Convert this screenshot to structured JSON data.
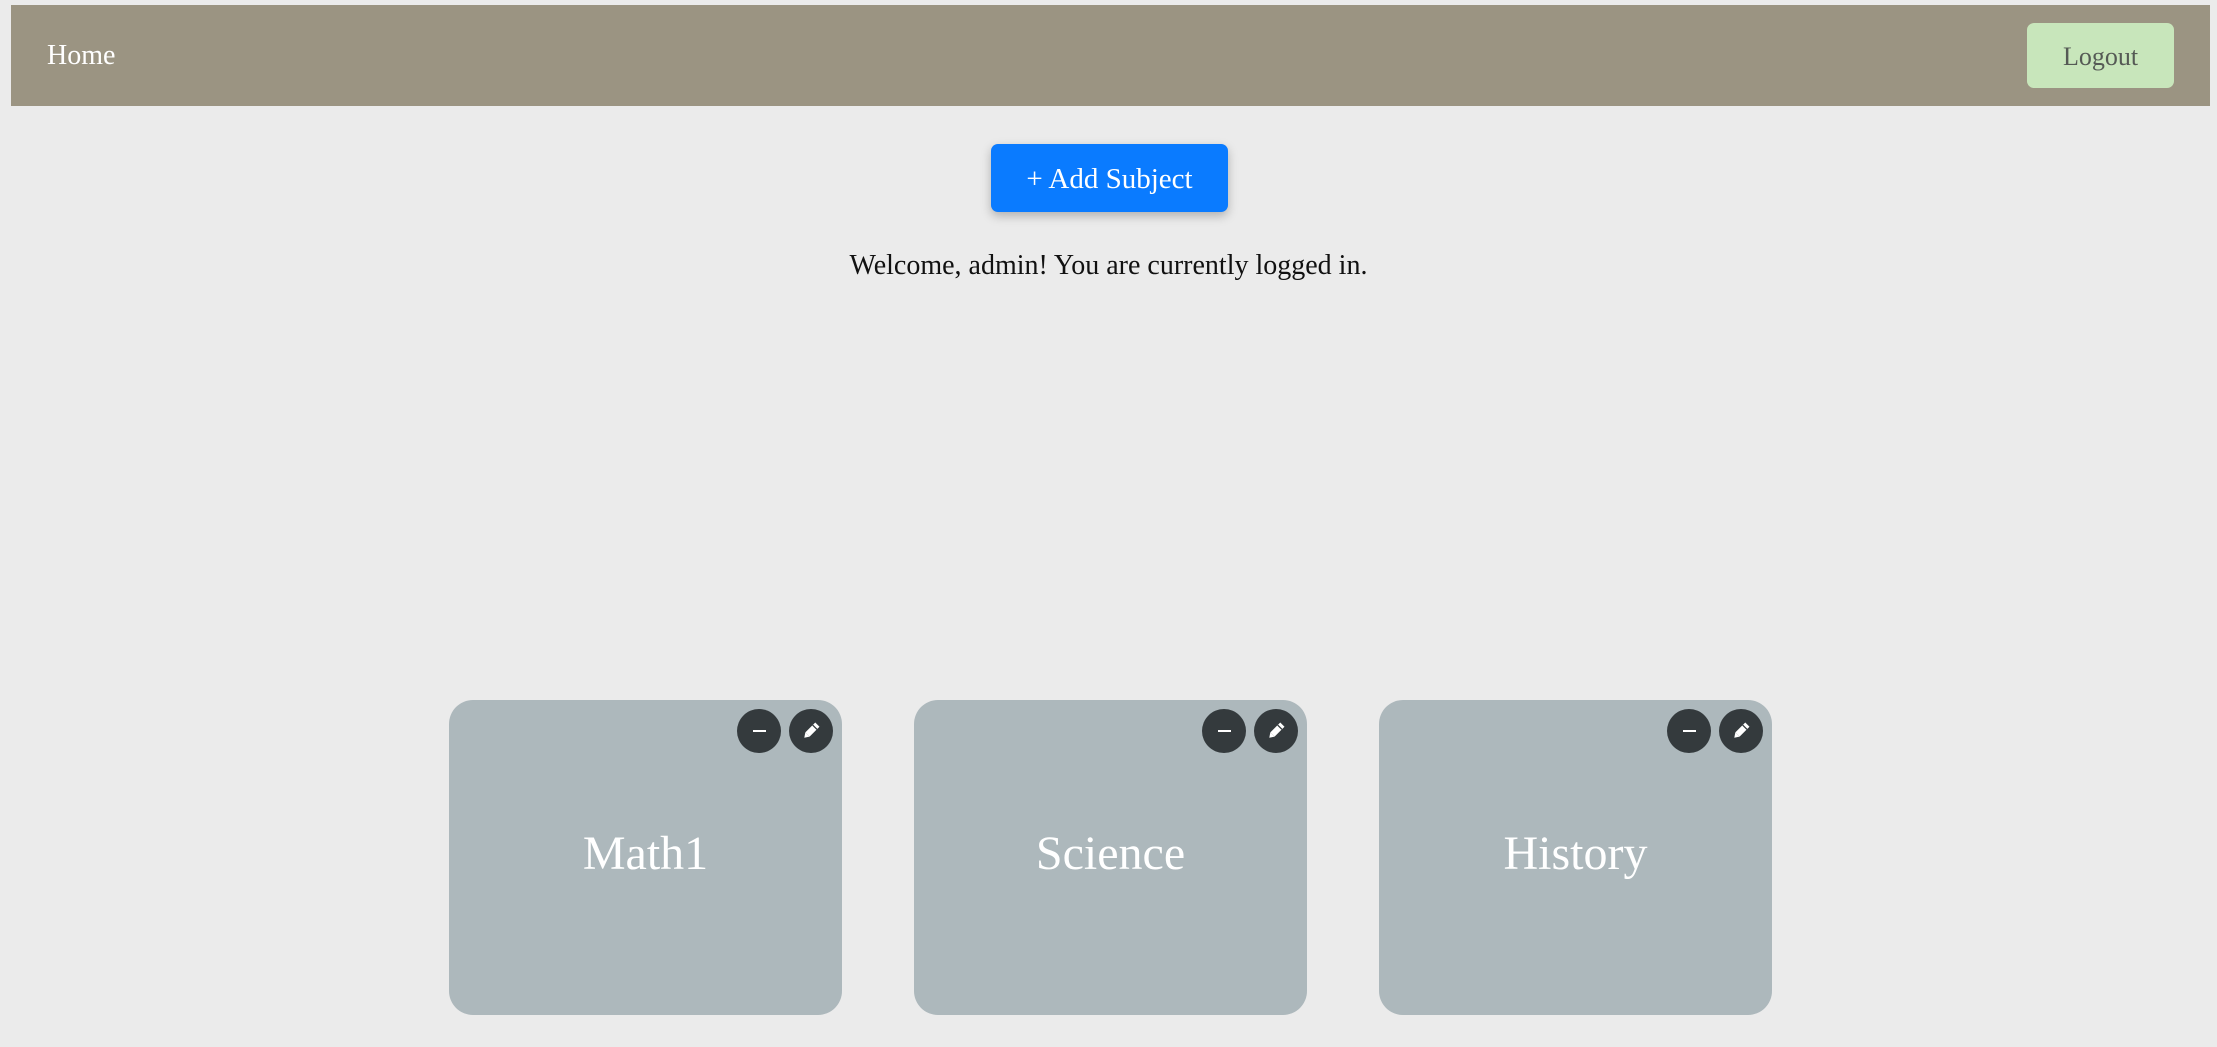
{
  "nav": {
    "home_label": "Home",
    "logout_label": "Logout"
  },
  "main": {
    "add_subject_label": "+ Add Subject",
    "welcome_text": "Welcome, admin! You are currently logged in."
  },
  "subjects": [
    {
      "name": "Math1"
    },
    {
      "name": "Science"
    },
    {
      "name": "History"
    }
  ],
  "icons": {
    "remove": "minus-icon",
    "edit": "pencil-icon"
  },
  "colors": {
    "navbar": "#9b9482",
    "logout_bg": "#c8e6bb",
    "add_button": "#0a7bff",
    "card_bg": "#adb8bc",
    "icon_button_bg": "#343a3d",
    "page_bg": "#ebebeb"
  }
}
